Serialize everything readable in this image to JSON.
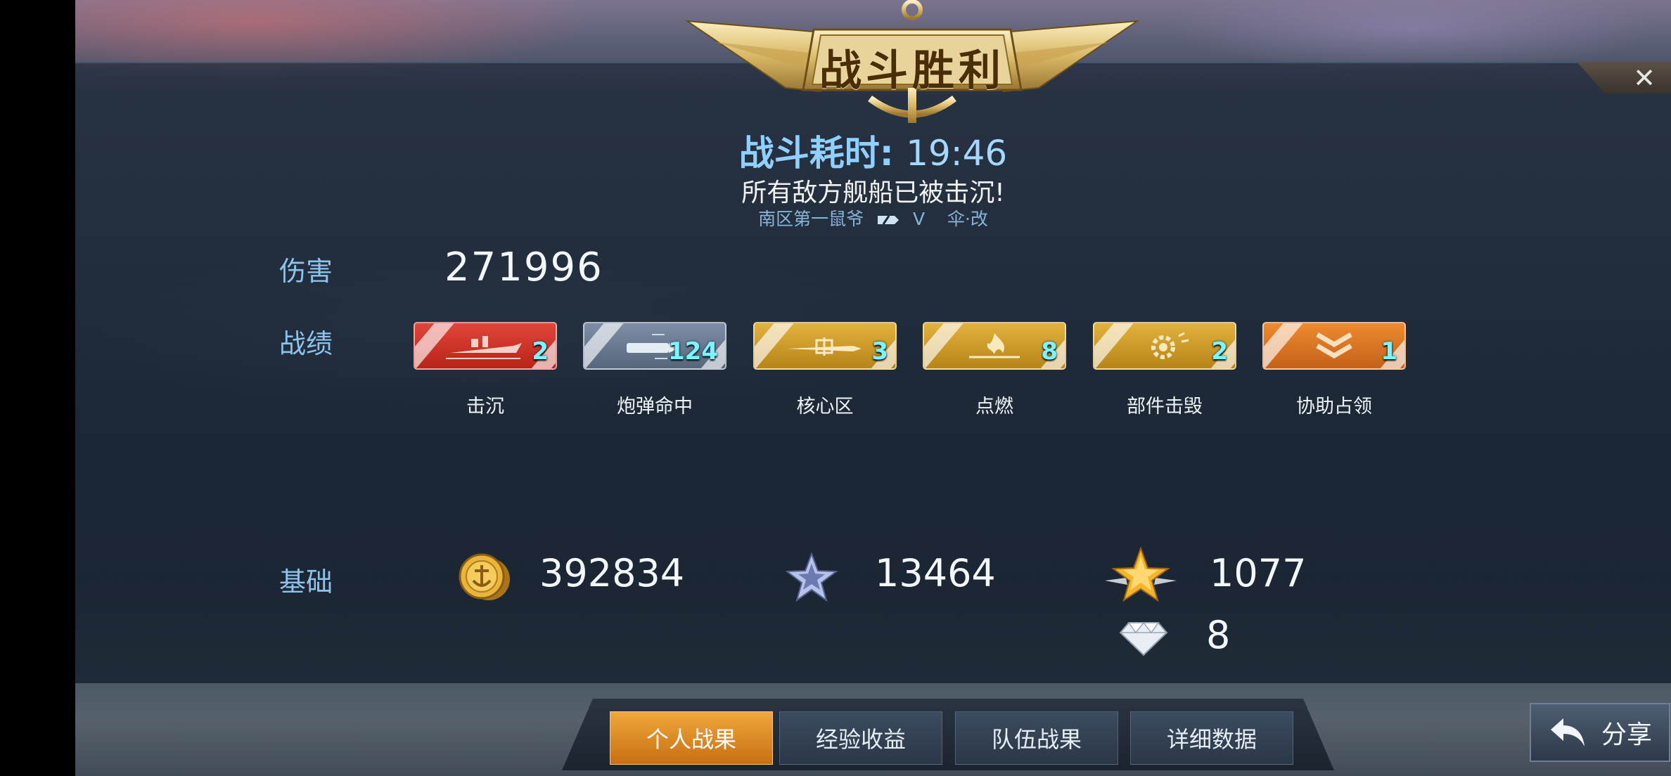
{
  "banner": {
    "title": "战斗胜利"
  },
  "battle": {
    "duration_label": "战斗耗时:",
    "duration_value": "19:46",
    "result_message": "所有敌方舰船已被击沉!",
    "player_name": "南区第一鼠爷",
    "ship_tier": "V",
    "ship_name": "伞·改"
  },
  "damage": {
    "label": "伤害",
    "value": "271996"
  },
  "achievements": {
    "label": "战绩",
    "items": [
      {
        "name": "击沉",
        "count": "2",
        "color": "#d0342a",
        "icon": "ship-icon"
      },
      {
        "name": "炮弹命中",
        "count": "124",
        "color": "#6b7c94",
        "icon": "shell-icon"
      },
      {
        "name": "核心区",
        "count": "3",
        "color": "#d09c2a",
        "icon": "citadel-icon"
      },
      {
        "name": "点燃",
        "count": "8",
        "color": "#d09c2a",
        "icon": "fire-icon"
      },
      {
        "name": "部件击毁",
        "count": "2",
        "color": "#d09c2a",
        "icon": "gear-icon"
      },
      {
        "name": "协助占领",
        "count": "1",
        "color": "#de7a26",
        "icon": "chevron-icon"
      }
    ]
  },
  "base": {
    "label": "基础",
    "silver": "392834",
    "ship_exp": "13464",
    "captain_exp": "1077",
    "diamonds": "8"
  },
  "tabs": [
    {
      "label": "个人战果",
      "active": true
    },
    {
      "label": "经验收益",
      "active": false
    },
    {
      "label": "队伍战果",
      "active": false
    },
    {
      "label": "详细数据",
      "active": false
    }
  ],
  "share": {
    "label": "分享"
  },
  "close": {
    "label": "✕"
  }
}
